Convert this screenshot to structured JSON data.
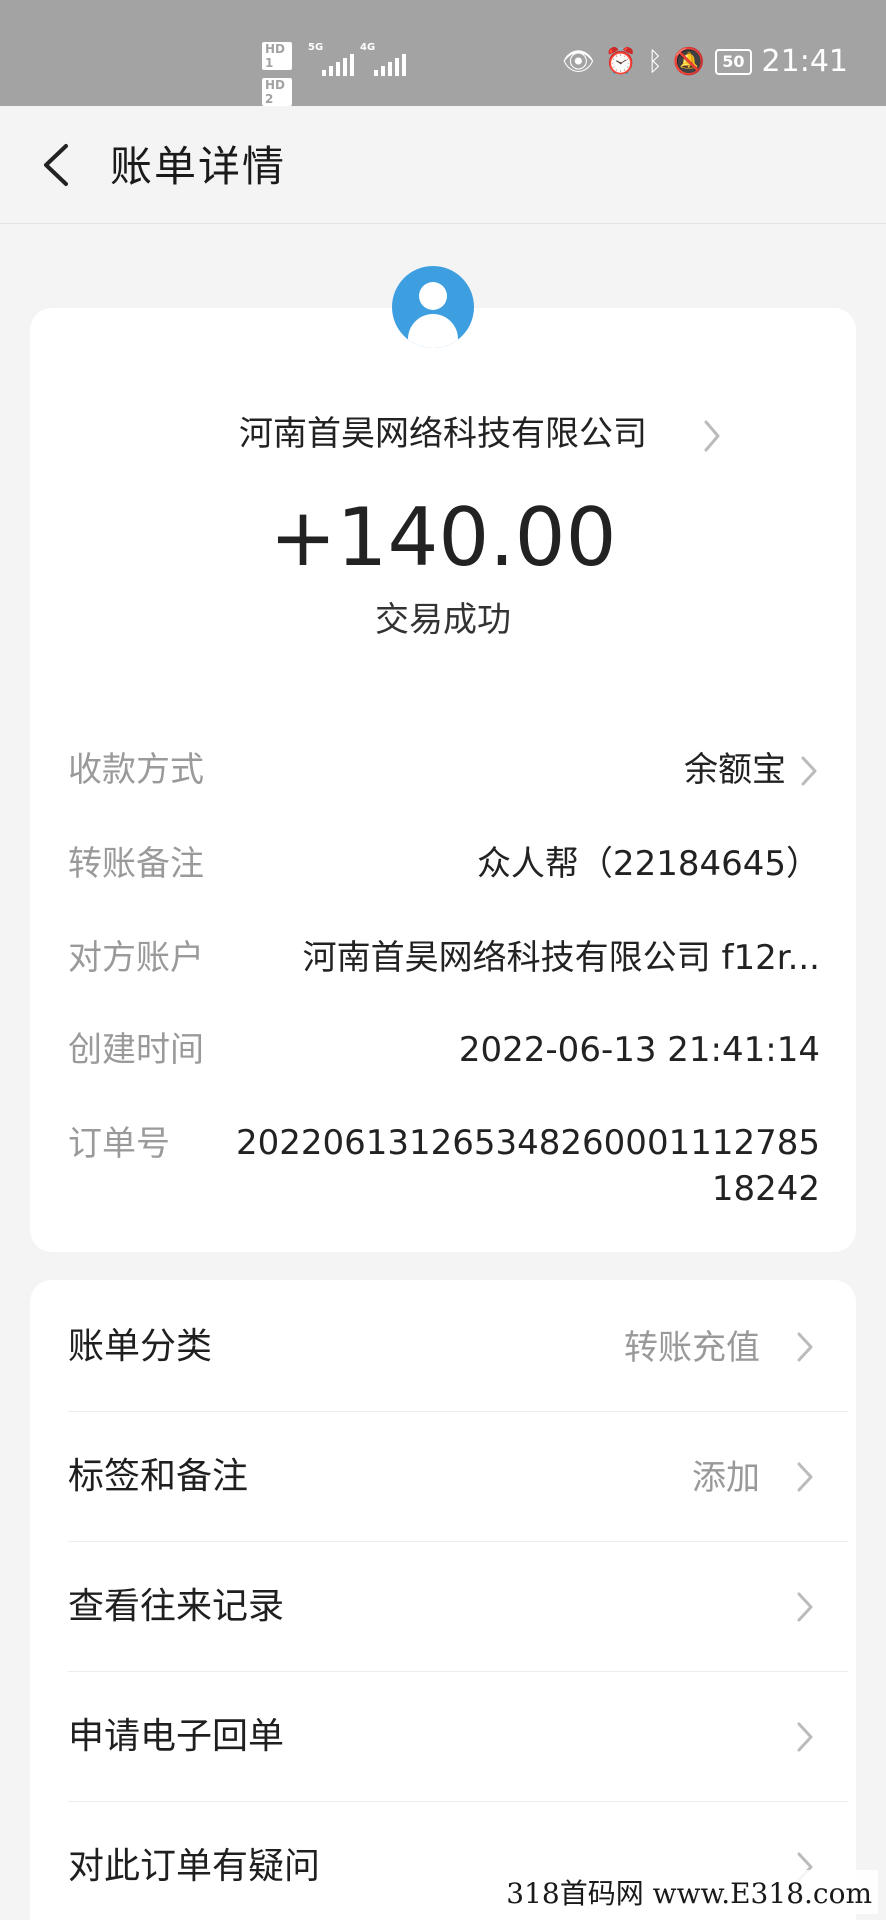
{
  "status_bar": {
    "hd1": "HD 1",
    "hd2": "HD 2",
    "net1": "5G",
    "net2": "4G",
    "battery": "50",
    "time": "21:41"
  },
  "header": {
    "title": "账单详情",
    "back_icon": "chevron-left-icon"
  },
  "summary": {
    "avatar_icon": "user-avatar-icon",
    "merchant": "河南首昊网络科技有限公司",
    "amount": "+140.00",
    "status": "交易成功"
  },
  "details": [
    {
      "label": "收款方式",
      "value": "余额宝",
      "has_chevron": true
    },
    {
      "label": "转账备注",
      "value": "众人帮（22184645）",
      "has_chevron": false
    },
    {
      "label": "对方账户",
      "value": "河南首昊网络科技有限公司  f12r...",
      "has_chevron": false
    },
    {
      "label": "创建时间",
      "value": "2022-06-13 21:41:14",
      "has_chevron": false
    },
    {
      "label": "订单号",
      "value": "2022061312653482600011127851 8242",
      "has_chevron": false
    }
  ],
  "order_no_line1": "202206131265348260001112785",
  "order_no_line2": "18242",
  "menu": [
    {
      "label": "账单分类",
      "value": "转账充值"
    },
    {
      "label": "标签和备注",
      "value": "添加"
    },
    {
      "label": "查看往来记录",
      "value": ""
    },
    {
      "label": "申请电子回单",
      "value": ""
    },
    {
      "label": "对此订单有疑问",
      "value": ""
    }
  ],
  "watermark": "318首码网  www.E318.com",
  "colors": {
    "status_bar": "#a3a3a3",
    "page_bg": "#f4f4f4",
    "avatar": "#3d9ee0",
    "label_gray": "#9a9a9a"
  }
}
